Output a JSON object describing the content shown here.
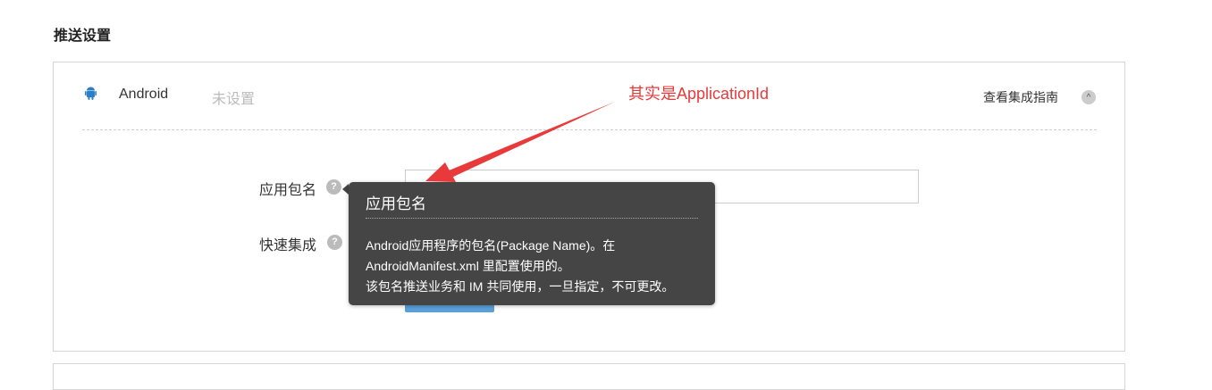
{
  "section_title": "推送设置",
  "platform": {
    "name": "Android",
    "status": "未设置",
    "guide_link": "查看集成指南",
    "collapse_icon": "chevron-up-icon"
  },
  "form": {
    "package_label": "应用包名",
    "quick_label": "快速集成",
    "help_icon": "?"
  },
  "tooltip": {
    "title": "应用包名",
    "lines": [
      "Android应用程序的包名(Package Name)。在",
      "AndroidManifest.xml 里配置使用的。",
      "该包名推送业务和 IM 共同使用，一旦指定，不可更改。"
    ]
  },
  "annotation": {
    "text": "其实是ApplicationId",
    "color": "#e83a3a"
  }
}
